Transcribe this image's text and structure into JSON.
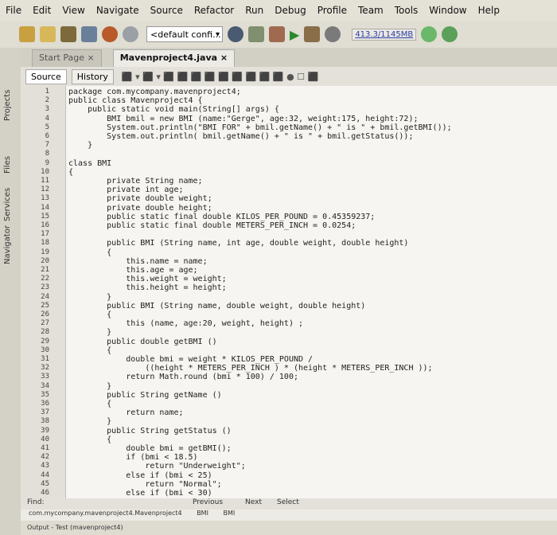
{
  "menu": [
    "File",
    "Edit",
    "View",
    "Navigate",
    "Source",
    "Refactor",
    "Run",
    "Debug",
    "Profile",
    "Team",
    "Tools",
    "Window",
    "Help"
  ],
  "toolbar": {
    "config": "<default confi...",
    "memory": "413.3/1145MB"
  },
  "left_tabs": [
    "Projects",
    "Files",
    "Services",
    "Navigator"
  ],
  "tabs": [
    {
      "label": "Start Page"
    },
    {
      "label": "Mavenproject4.java"
    }
  ],
  "editor_toolbar": {
    "source": "Source",
    "history": "History"
  },
  "lines": [
    {
      "n": "1",
      "t": "package com.mycompany.mavenproject4;"
    },
    {
      "n": "2",
      "t": "public class Mavenproject4 {"
    },
    {
      "n": "3",
      "t": "    public static void main(String[] args) {"
    },
    {
      "n": "4",
      "t": "        BMI bmil = new BMI (name:\"Gerge\", age:32, weight:175, height:72);"
    },
    {
      "n": "5",
      "t": "        System.out.println(\"BMI FOR\" + bmil.getName() + \" is \" + bmil.getBMI());"
    },
    {
      "n": "6",
      "t": "        System.out.println( bmil.getName() + \" is \" + bmil.getStatus());"
    },
    {
      "n": "7",
      "t": "    }"
    },
    {
      "n": "8",
      "t": ""
    },
    {
      "n": "9",
      "t": "class BMI"
    },
    {
      "n": "10",
      "t": "{"
    },
    {
      "n": "11",
      "t": "        private String name;"
    },
    {
      "n": "12",
      "t": "        private int age;"
    },
    {
      "n": "13",
      "t": "        private double weight;"
    },
    {
      "n": "14",
      "t": "        private double height;"
    },
    {
      "n": "15",
      "t": "        public static final double KILOS_PER_POUND = 0.45359237;"
    },
    {
      "n": "16",
      "t": "        public static final double METERS_PER_INCH = 0.0254;"
    },
    {
      "n": "17",
      "t": ""
    },
    {
      "n": "18",
      "t": "        public BMI (String name, int age, double weight, double height)"
    },
    {
      "n": "19",
      "t": "        {"
    },
    {
      "n": "20",
      "t": "            this.name = name;"
    },
    {
      "n": "21",
      "t": "            this.age = age;"
    },
    {
      "n": "22",
      "t": "            this.weight = weight;"
    },
    {
      "n": "23",
      "t": "            this.height = height;"
    },
    {
      "n": "24",
      "t": "        }"
    },
    {
      "n": "25",
      "t": "        public BMI (String name, double weight, double height)"
    },
    {
      "n": "26",
      "t": "        {"
    },
    {
      "n": "27",
      "t": "            this (name, age:20, weight, height) ;"
    },
    {
      "n": "28",
      "t": "        }"
    },
    {
      "n": "29",
      "t": "        public double getBMI ()"
    },
    {
      "n": "30",
      "t": "        {"
    },
    {
      "n": "31",
      "t": "            double bmi = weight * KILOS_PER_POUND /"
    },
    {
      "n": "32",
      "t": "                ((height * METERS_PER_INCH ) * (height * METERS_PER_INCH ));"
    },
    {
      "n": "33",
      "t": "            return Math.round (bmi * 100) / 100;"
    },
    {
      "n": "34",
      "t": "        }"
    },
    {
      "n": "35",
      "t": "        public String getName ()"
    },
    {
      "n": "36",
      "t": "        {"
    },
    {
      "n": "37",
      "t": "            return name;"
    },
    {
      "n": "38",
      "t": "        }"
    },
    {
      "n": "39",
      "t": "        public String getStatus ()"
    },
    {
      "n": "40",
      "t": "        {"
    },
    {
      "n": "41",
      "t": "            double bmi = getBMI();"
    },
    {
      "n": "42",
      "t": "            if (bmi < 18.5)"
    },
    {
      "n": "43",
      "t": "                return \"Underweight\";"
    },
    {
      "n": "44",
      "t": "            else if (bmi < 25)"
    },
    {
      "n": "45",
      "t": "                return \"Normal\";"
    },
    {
      "n": "46",
      "t": "            else if (bmi < 30)"
    }
  ],
  "find": {
    "label": "Find:",
    "previous": "Previous",
    "next": "Next",
    "select": "Select"
  },
  "crumb": {
    "path": "com.mycompany.mavenproject4.Mavenproject4",
    "c1": "BMI",
    "c2": "BMI"
  },
  "output": {
    "label": "Output - Test (mavenproject4)"
  }
}
